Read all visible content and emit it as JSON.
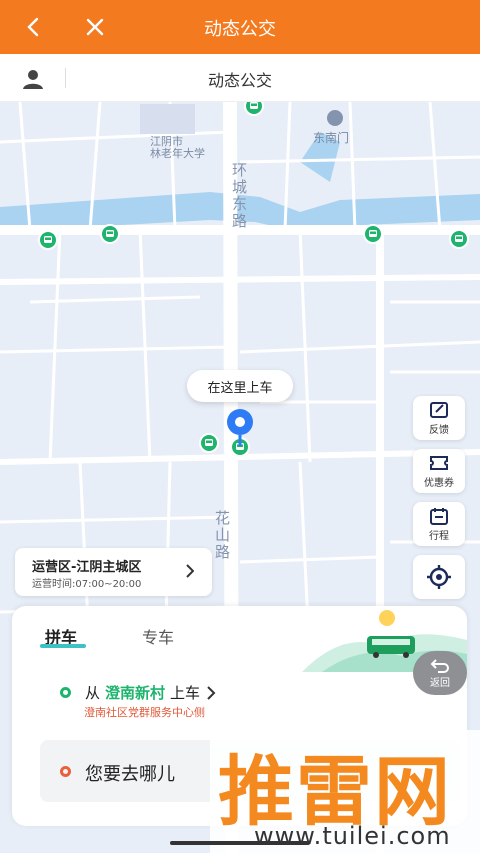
{
  "topbar": {
    "title": "动态公交",
    "back_icon": "chevron-left-icon",
    "close_icon": "close-icon",
    "color": "#F47A1F"
  },
  "subbar": {
    "title": "动态公交",
    "user_icon": "user-icon"
  },
  "map": {
    "labels": {
      "school": "江阴市\n林老年大学",
      "gate": "东南门",
      "road1": "环城东路",
      "road2": "花山路"
    },
    "pickup_bubble": "在这里上车"
  },
  "side_buttons": [
    {
      "label": "反馈",
      "icon": "feedback-icon"
    },
    {
      "label": "优惠券",
      "icon": "coupon-icon"
    },
    {
      "label": "行程",
      "icon": "trip-icon"
    },
    {
      "label": "",
      "icon": "locate-icon"
    }
  ],
  "area_card": {
    "name": "运营区-江阴主城区",
    "time": "运营时间:07:00~20:00"
  },
  "panel": {
    "tabs": [
      "拼车",
      "专车"
    ],
    "from_prefix": "从",
    "from_station": "澄南新村",
    "from_suffix": "上车",
    "from_sub": "澄南社区党群服务中心侧",
    "dest_placeholder": "您要去哪儿"
  },
  "back_button": {
    "label": "返回"
  },
  "watermark": {
    "big": "推雷网",
    "small": "www.tuilei.com"
  }
}
